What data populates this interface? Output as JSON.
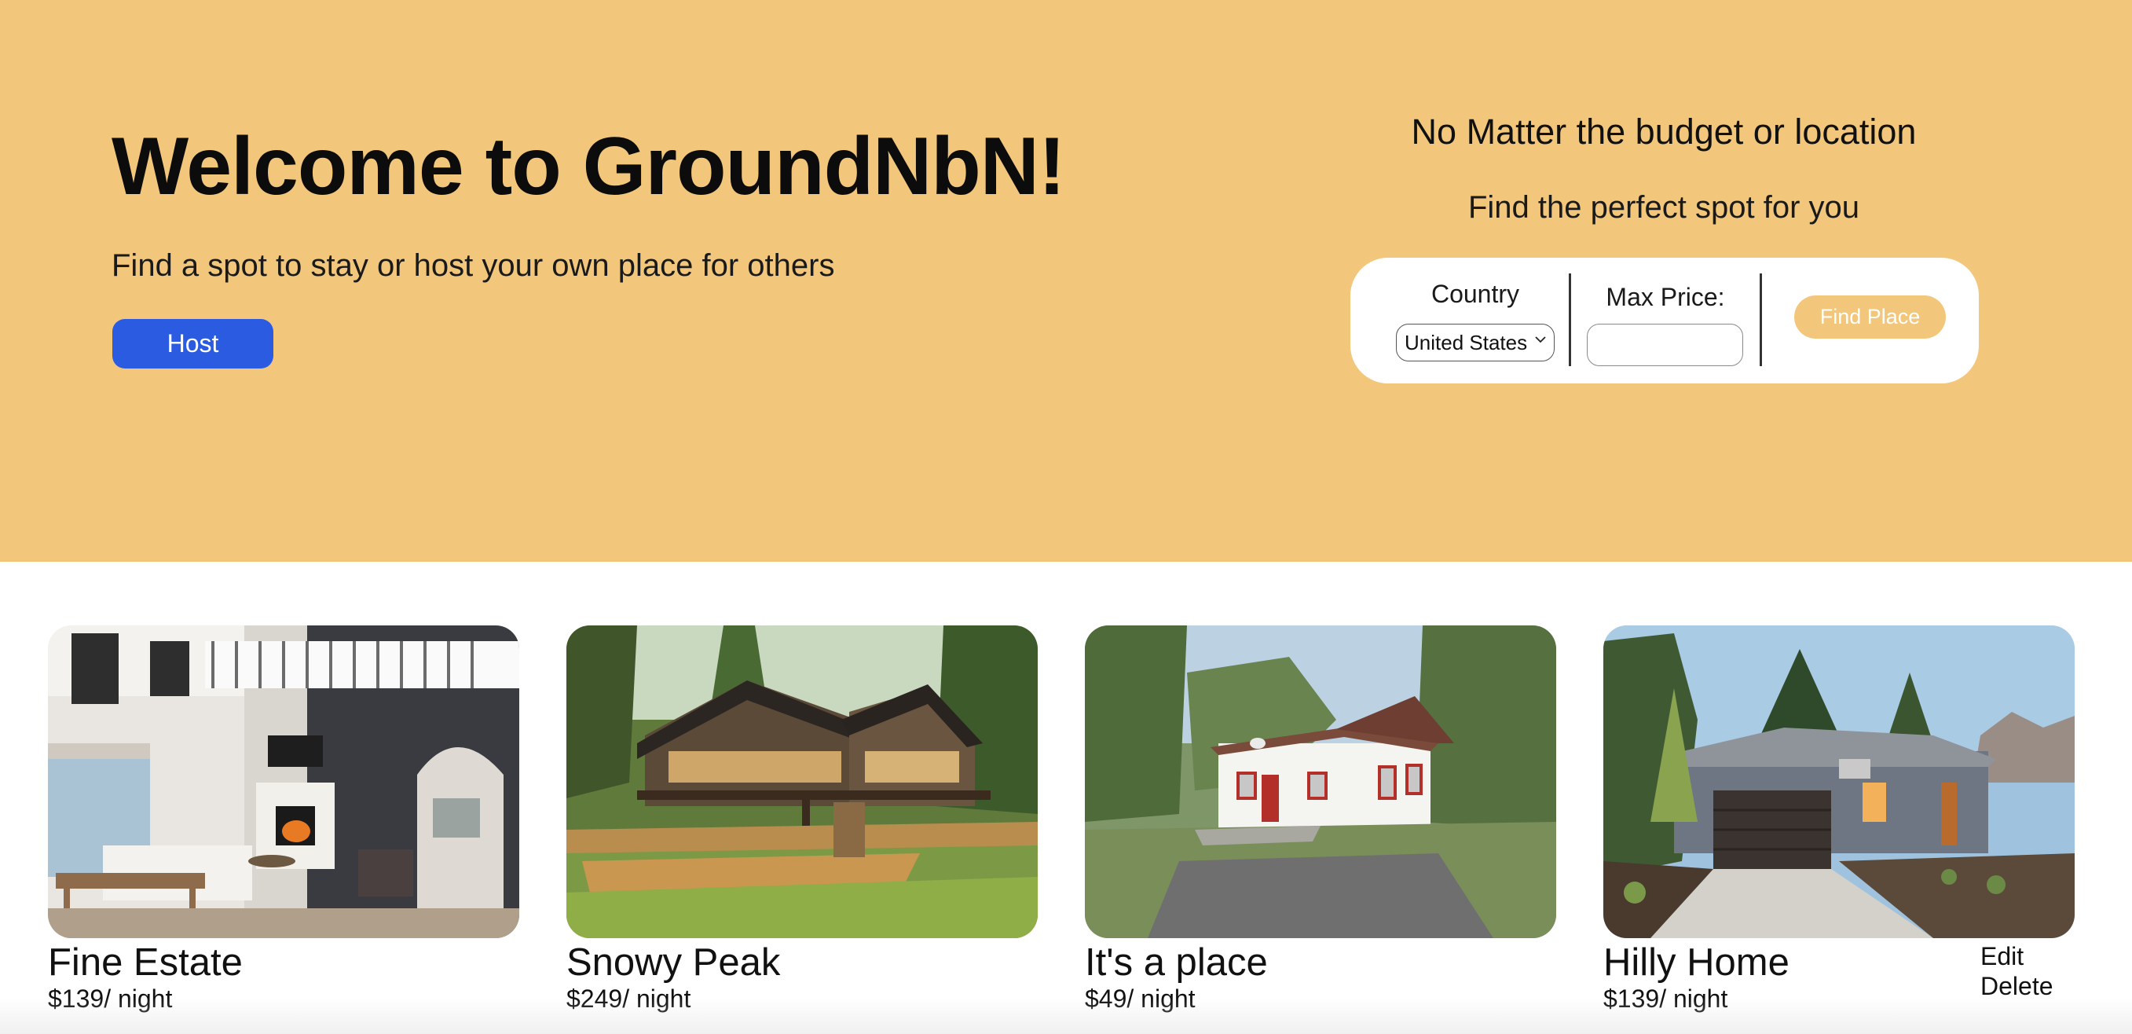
{
  "hero": {
    "title": "Welcome to GroundNbN!",
    "subtitle": "Find a spot to stay or host your own place for others",
    "host_button": "Host",
    "background_color": "#f2c77b",
    "host_button_color": "#2b5be0"
  },
  "search": {
    "heading": "No Matter the budget or location",
    "tagline": "Find the perfect spot for you",
    "country_label": "Country",
    "country_selected": "United States",
    "price_label": "Max Price:",
    "price_value": "",
    "find_button": "Find Place"
  },
  "listings": [
    {
      "title": "Fine Estate",
      "price": "$139/ night",
      "photo_icon": "living-room-photo"
    },
    {
      "title": "Snowy Peak",
      "price": "$249/ night",
      "photo_icon": "forest-lodge-photo"
    },
    {
      "title": "It's a place",
      "price": "$49/ night",
      "photo_icon": "small-cabin-photo"
    },
    {
      "title": "Hilly Home",
      "price": "$139/ night",
      "photo_icon": "suburban-house-photo",
      "edit_label": "Edit",
      "delete_label": "Delete"
    }
  ]
}
